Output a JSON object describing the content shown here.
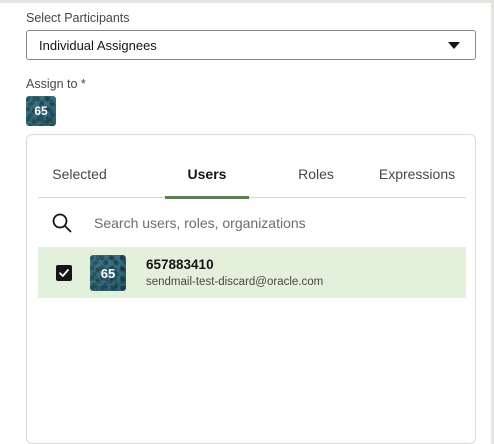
{
  "participants": {
    "label": "Select Participants",
    "selected_value": "Individual Assignees"
  },
  "assign_to": {
    "label": "Assign to *",
    "chip_initials": "65"
  },
  "tabs": [
    {
      "label": "Selected",
      "active": false
    },
    {
      "label": "Users",
      "active": true
    },
    {
      "label": "Roles",
      "active": false
    },
    {
      "label": "Expressions",
      "active": false
    }
  ],
  "search": {
    "placeholder": "Search users, roles, organizations",
    "icon": "search-icon"
  },
  "results": [
    {
      "checked": true,
      "avatar_initials": "65",
      "name": "657883410",
      "email": "sendmail-test-discard@oracle.com"
    }
  ],
  "colors": {
    "active_tab_underline": "#5b7f52",
    "selected_row_bg": "#e3f0dc",
    "avatar_bg": "#2f6c80"
  }
}
